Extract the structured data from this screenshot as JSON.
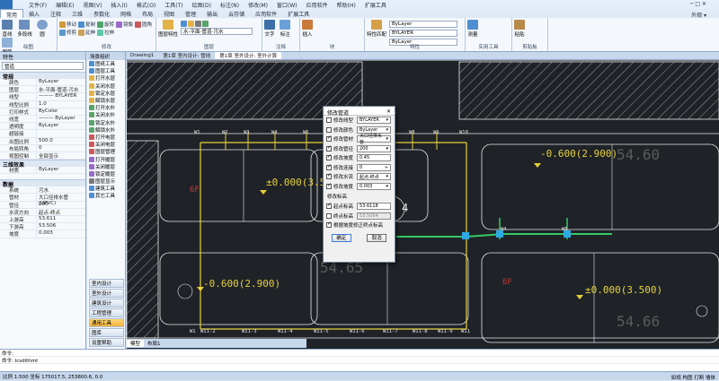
{
  "menu": {
    "items": [
      "文件(F)",
      "编辑(E)",
      "视图(V)",
      "插入(I)",
      "格式(O)",
      "工具(T)",
      "绘图(D)",
      "标注(N)",
      "修改(M)",
      "窗口(W)",
      "应用软件",
      "帮助(H)",
      "扩展工具"
    ],
    "right": "─ □ ✕"
  },
  "tabs": {
    "items": [
      "常用",
      "插入",
      "注释",
      "三维",
      "参数化",
      "网格",
      "布局",
      "视图",
      "管理",
      "输出",
      "云存储",
      "应用软件",
      "扩展工具"
    ],
    "right": "外观 ▾"
  },
  "ribbon": {
    "draw": {
      "label": "绘图",
      "b1": "直线",
      "b2": "多段线",
      "b3": "圆",
      "b4": "圆弧"
    },
    "modify": {
      "label": "修改",
      "b1": "移动",
      "b2": "复制",
      "b3": "旋转",
      "b4": "镜像",
      "b5": "圆角",
      "b6": "修剪",
      "b7": "延伸",
      "b8": "拉伸"
    },
    "layer": {
      "label": "图层",
      "big": "图层特性",
      "combo": "水-平面-管道-污水"
    },
    "anno": {
      "label": "注释",
      "b1": "文字",
      "b2": "标注"
    },
    "block": {
      "label": "块",
      "b1": "插入"
    },
    "props": {
      "label": "特性",
      "big": "特性匹配",
      "c1": "ByLayer",
      "c2": "BYLAYER",
      "c3": "ByLayer"
    },
    "util": {
      "label": "实用工具",
      "b1": "测量"
    },
    "clip": {
      "label": "剪贴板",
      "b1": "粘贴"
    }
  },
  "docbar": {
    "tabs": [
      "Drawing1",
      "第1章 室内设计: 管线",
      "第1章 室外设计: 室外计算"
    ]
  },
  "properties": {
    "title": "特性",
    "selector": "管道",
    "sections": [
      {
        "name": "常规",
        "rows": [
          {
            "k": "颜色",
            "v": "ByLayer"
          },
          {
            "k": "图层",
            "v": "水-平面-管道-污水"
          },
          {
            "k": "线型",
            "v": "——— BYLAYER"
          },
          {
            "k": "线型比例",
            "v": "1.0"
          },
          {
            "k": "打印样式",
            "v": "ByColor"
          },
          {
            "k": "线宽",
            "v": "——— ByLayer"
          },
          {
            "k": "透明度",
            "v": "ByLayer"
          },
          {
            "k": "超链接",
            "v": ""
          },
          {
            "k": "出图比例",
            "v": "500.0"
          },
          {
            "k": "布局转角",
            "v": "0"
          },
          {
            "k": "视图控制",
            "v": "全部显示"
          }
        ]
      },
      {
        "name": "三维效果",
        "rows": [
          {
            "k": "材质",
            "v": "ByLayer"
          }
        ]
      },
      {
        "name": "数据",
        "rows": [
          {
            "k": "系统",
            "v": "污水"
          },
          {
            "k": "管材",
            "v": "大口径排水管(UPVC)"
          },
          {
            "k": "管径",
            "v": "200"
          },
          {
            "k": "水流方向",
            "v": "起点-终点"
          },
          {
            "k": "上游高",
            "v": "53.611"
          },
          {
            "k": "下游高",
            "v": "53.506"
          },
          {
            "k": "坡度",
            "v": "0.003"
          }
        ]
      }
    ]
  },
  "tree": {
    "title": "场景组织",
    "items": [
      "图纸工具",
      "图层工具",
      "打开水层",
      "关闭水层",
      "锁定水层",
      "解锁水层",
      "打开水外",
      "关闭水外",
      "锁定水外",
      "解锁水外",
      "打开电层",
      "关闭电层",
      "图层管理",
      "打开暖层",
      "关闭暖层",
      "锁定暖层",
      "图层显示",
      "建筑工具",
      "其它工具"
    ],
    "nav": [
      "室内设计",
      "室外设计",
      "建筑设计",
      "工程管理",
      "通用工具",
      "图库",
      "设置帮助"
    ]
  },
  "canvas": {
    "labels_top": [
      "W1",
      "W2",
      "W3",
      "W4",
      "W5",
      "W6",
      "W7",
      "W8",
      "W9",
      "W10"
    ],
    "labels_bottom": [
      "W1",
      "W11-2",
      "W11-3",
      "W11-4",
      "W11-5",
      "W11-6",
      "W11-7",
      "W11-8",
      "W11-9",
      "W11"
    ],
    "elev1": "±0.000(3.500)",
    "elev2": "-0.600(2.900)",
    "elev3": "-0.600(2.900)",
    "elev4": "±0.000(3.500)",
    "big1": "54.60",
    "big2": "54.65",
    "big3": "54.66",
    "f1": "6F",
    "f2": "6F",
    "n4": "4",
    "w4": "W4",
    "w5": "W5"
  },
  "dialog": {
    "title": "修改管道",
    "close": "✕",
    "rows": [
      {
        "label": "修改线型",
        "value": "BYLAYER",
        "checked": false
      },
      {
        "label": "修改颜色",
        "value": "ByLayer",
        "checked": false
      },
      {
        "label": "修改管材",
        "value": "大口径排水管",
        "checked": true
      },
      {
        "label": "修改管径",
        "value": "200",
        "checked": true
      },
      {
        "label": "修改坡度",
        "value": "0.45",
        "checked": true
      },
      {
        "label": "修改连接",
        "value": "0",
        "checked": true
      },
      {
        "label": "修改水流",
        "value": "起点-终点",
        "checked": true
      },
      {
        "label": "修改坡度",
        "value": "0.003",
        "checked": true
      }
    ],
    "elev_title": "修改标高",
    "start_label": "起点标高",
    "start_value": "53.6118",
    "end_label": "终点标高",
    "end_value": "53.5064",
    "keep_label": "根据坡度修正终点标高",
    "ok": "确定",
    "cancel": "取消"
  },
  "layout_tabs": [
    "模型",
    "布局1"
  ],
  "command": {
    "line1": "命令:",
    "line2": "命令: Icsdithmt"
  },
  "status": {
    "left": "比例 1:500  坐标 175017.5, 253800.6, 0.0",
    "right": "如规  构图  打断  墙体"
  }
}
